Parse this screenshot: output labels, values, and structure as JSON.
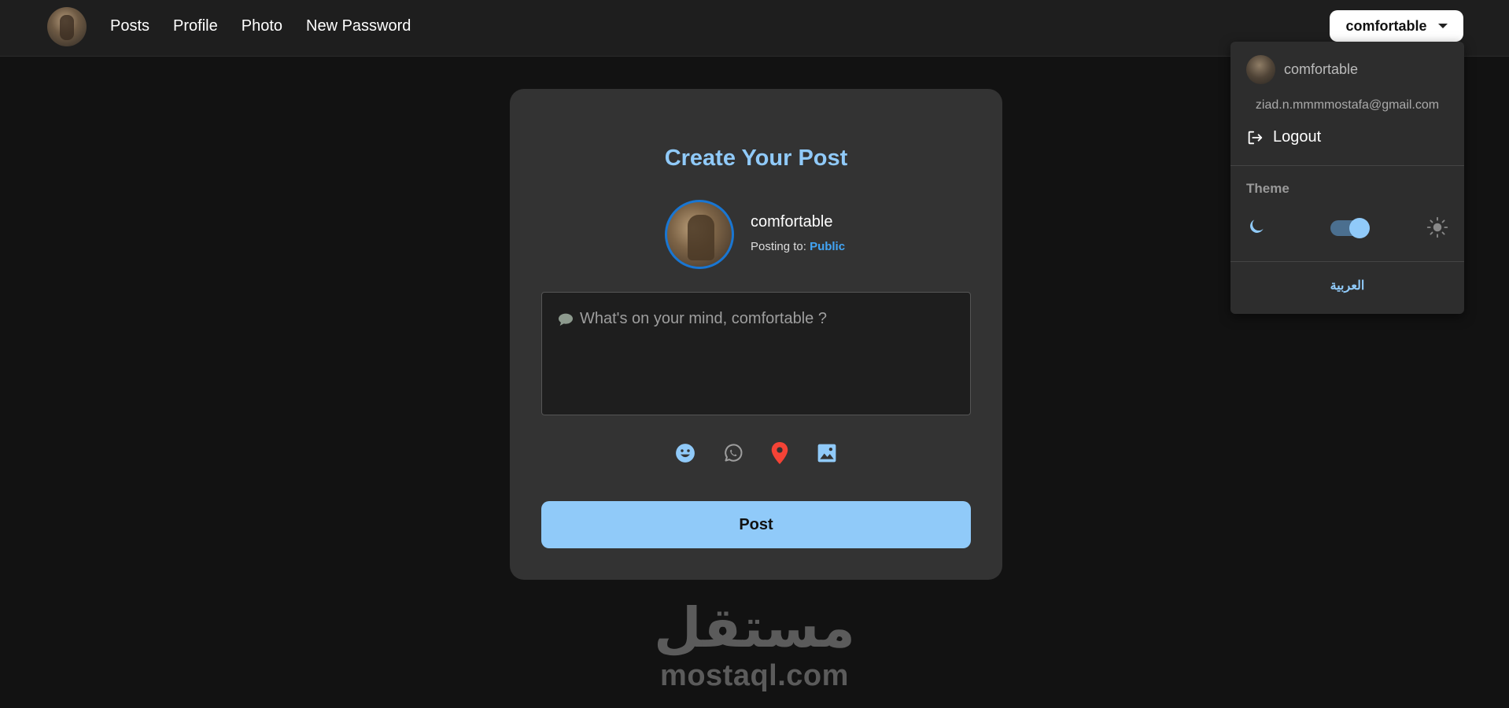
{
  "navbar": {
    "links": [
      "Posts",
      "Profile",
      "Photo",
      "New Password"
    ],
    "user_button": "comfortable"
  },
  "dropdown": {
    "username": "comfortable",
    "email": "ziad.n.mmmmostafa@gmail.com",
    "logout_label": "Logout",
    "theme_label": "Theme",
    "theme_dark_enabled": true,
    "language_label": "العربية"
  },
  "composer": {
    "title": "Create Your Post",
    "username": "comfortable",
    "posting_to_label": "Posting to:",
    "audience": "Public",
    "placeholder": "What's on your mind, comfortable ?",
    "action_icons": [
      "emoji-icon",
      "whatsapp-icon",
      "location-pin-icon",
      "image-icon"
    ],
    "post_button": "Post"
  },
  "watermark": {
    "arabic": "مستقل",
    "latin": "mostaql.com"
  },
  "colors": {
    "accent": "#90caf9",
    "audience_link": "#42a5f5",
    "location_pin": "#f44336",
    "background": "#121212",
    "card": "#333333"
  }
}
